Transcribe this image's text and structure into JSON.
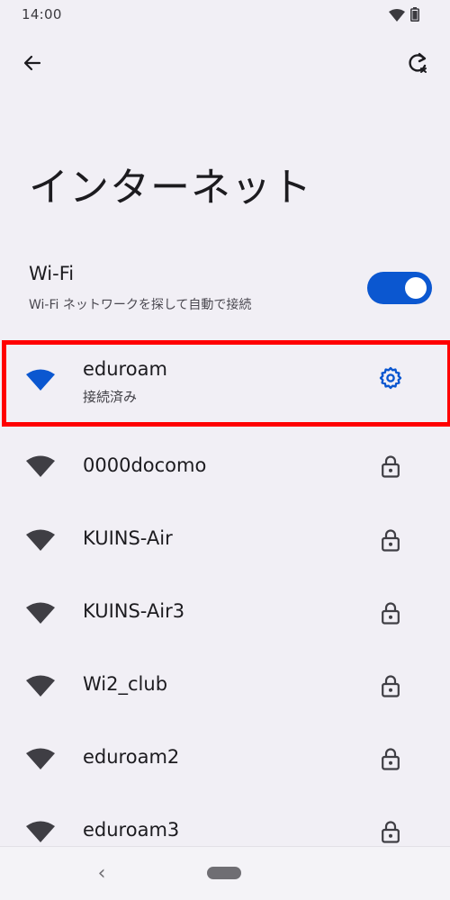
{
  "status_bar": {
    "time": "14:00",
    "icons": [
      "wifi-signal-icon",
      "battery-icon"
    ]
  },
  "top_bar": {
    "back_icon": "arrow-left-icon",
    "refresh_icon": "refresh-icon"
  },
  "page": {
    "title": "インターネット"
  },
  "wifi": {
    "title": "Wi-Fi",
    "subtitle": "Wi-Fi ネットワークを探して自動で接続",
    "enabled": true
  },
  "networks": [
    {
      "name": "eduroam",
      "status": "接続済み",
      "connected": true,
      "trailing_icon": "gear-icon"
    },
    {
      "name": "0000docomo",
      "trailing_icon": "lock-icon"
    },
    {
      "name": "KUINS-Air",
      "trailing_icon": "lock-icon"
    },
    {
      "name": "KUINS-Air3",
      "trailing_icon": "lock-icon"
    },
    {
      "name": "Wi2_club",
      "trailing_icon": "lock-icon"
    },
    {
      "name": "eduroam2",
      "trailing_icon": "lock-icon"
    },
    {
      "name": "eduroam3",
      "trailing_icon": "lock-icon"
    }
  ],
  "colors": {
    "accent": "#0b57d0",
    "highlight": "#ff0000",
    "background": "#f1eff5",
    "icon": "#3f3e44"
  },
  "nav_bar": {
    "back_glyph": "‹"
  }
}
